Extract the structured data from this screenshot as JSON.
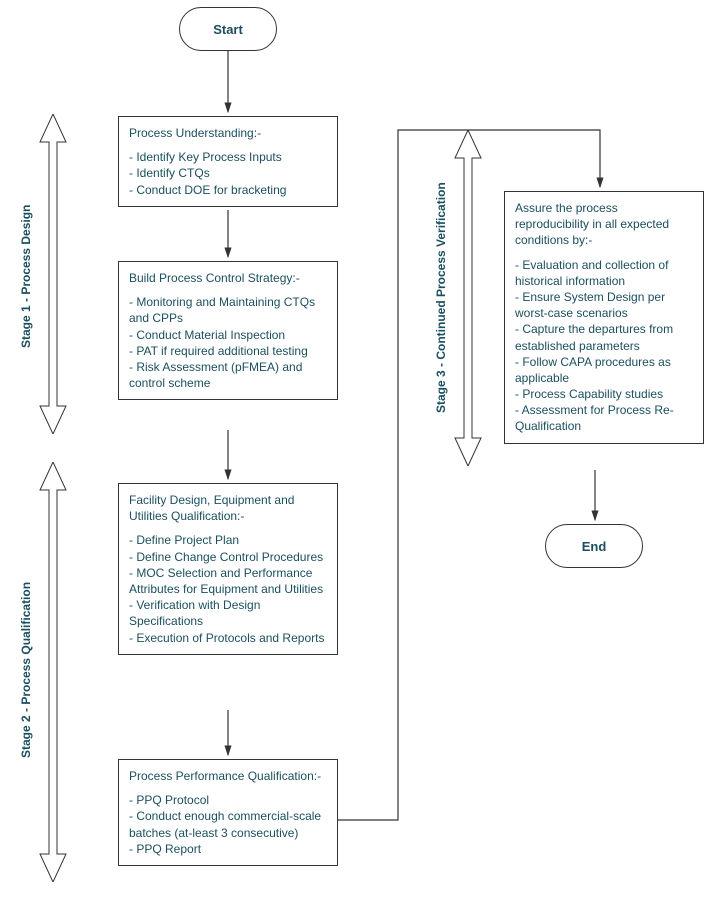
{
  "start": "Start",
  "end": "End",
  "stage1_label": "Stage 1 - Process Design",
  "stage2_label": "Stage 2 - Process Qualification",
  "stage3_label": "Stage 3 - Continued Process Verification",
  "box1": {
    "title": "Process Understanding:-",
    "items": [
      "Identify Key Process Inputs",
      "Identify CTQs",
      "Conduct DOE for bracketing"
    ]
  },
  "box2": {
    "title": "Build Process Control Strategy:-",
    "items": [
      "Monitoring and Maintaining CTQs and CPPs",
      "Conduct Material Inspection",
      "PAT if required additional testing",
      "Risk Assessment (pFMEA) and control scheme"
    ]
  },
  "box3": {
    "title": "Facility Design, Equipment and Utilities Qualification:-",
    "items": [
      "Define Project Plan",
      "Define Change Control Procedures",
      "MOC Selection and Performance Attributes for Equipment and Utilities",
      "Verification with Design Specifications",
      "Execution of Protocols and Reports"
    ]
  },
  "box4": {
    "title": "Process Performance Qualification:-",
    "items": [
      "PPQ Protocol",
      "Conduct enough commercial-scale batches (at-least 3 consecutive)",
      "PPQ Report"
    ]
  },
  "box5": {
    "title": "Assure the process reproducibility in all expected conditions by:-",
    "items": [
      "Evaluation and collection of historical information",
      "Ensure System Design per worst-case scenarios",
      "Capture the departures from established parameters",
      "Follow CAPA procedures as applicable",
      "Process Capability studies",
      "Assessment for Process Re-Qualification"
    ]
  }
}
